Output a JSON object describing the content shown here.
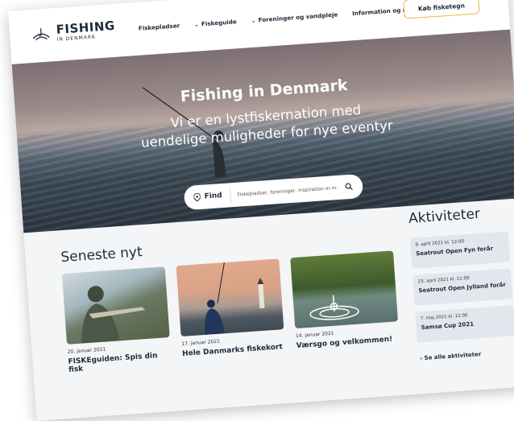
{
  "brand": {
    "title": "FISHING",
    "subtitle": "IN DENMARK"
  },
  "nav": {
    "items": [
      {
        "label": "Fiskepladser",
        "dropdown": false
      },
      {
        "label": "Fiskeguide",
        "dropdown": true
      },
      {
        "label": "Foreninger og vandpleje",
        "dropdown": true
      },
      {
        "label": "Information og regler",
        "dropdown": false
      }
    ],
    "cta_label": "Køb fisketegn"
  },
  "hero": {
    "title": "Fishing in Denmark",
    "subtitle": "Vi er en lystfiskernation med uendelige muligheder for nye eventyr"
  },
  "search": {
    "find_label": "Find",
    "placeholder": "Fiskepladser, foreninger, inspiration m.m."
  },
  "news": {
    "heading": "Seneste nyt",
    "items": [
      {
        "date": "20. januar 2021",
        "title": "FISKEguiden: Spis din fisk"
      },
      {
        "date": "17. januar 2021",
        "title": "Hele Danmarks fiskekort"
      },
      {
        "date": "14. januar 2021",
        "title": "Værsgo og velkommen!"
      }
    ]
  },
  "activities": {
    "heading": "Aktiviteter",
    "items": [
      {
        "date": "9. april 2021 kl. 12:00",
        "title": "Seatrout Open Fyn forår"
      },
      {
        "date": "23. april 2021 kl. 12:00",
        "title": "Seatrout Open Jylland forår"
      },
      {
        "date": "7. maj 2021 kl. 12:00",
        "title": "Samsø Cup 2021"
      }
    ],
    "see_all": "Se alle aktiviteter"
  },
  "colors": {
    "accent": "#e9b949",
    "text": "#1c2b3a",
    "card_bg": "#e1e7ec"
  }
}
